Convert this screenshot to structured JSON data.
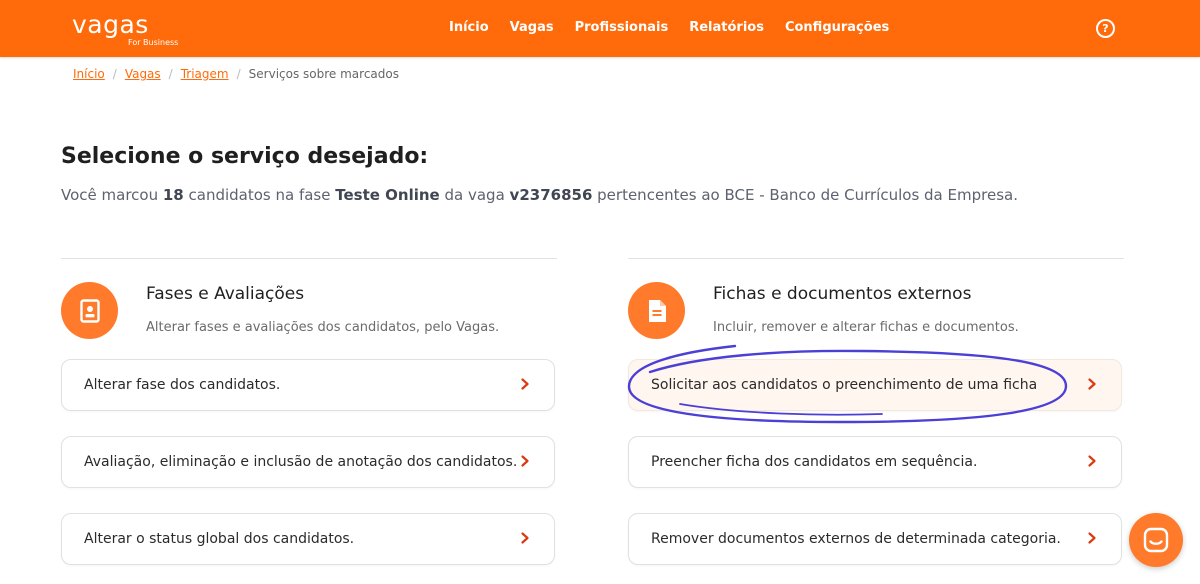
{
  "header": {
    "logo": "vagas",
    "logo_sub": "For Business",
    "nav": [
      "Início",
      "Vagas",
      "Profissionais",
      "Relatórios",
      "Configurações"
    ],
    "help_label": "?"
  },
  "breadcrumb": {
    "items": [
      "Início",
      "Vagas",
      "Triagem"
    ],
    "current": "Serviços sobre marcados"
  },
  "page": {
    "title": "Selecione o serviço desejado:",
    "desc_1": "Você marcou ",
    "count": "18",
    "desc_2": " candidatos na fase ",
    "phase": "Teste Online",
    "desc_3": " da vaga ",
    "job": "v2376856",
    "desc_4": " pertencentes ao BCE - Banco de Currículos da Empresa."
  },
  "sections": [
    {
      "title": "Fases e Avaliações",
      "subtitle": "Alterar fases e avaliações dos candidatos, pelo Vagas.",
      "icon": "id-badge-icon",
      "items": [
        "Alterar fase dos candidatos.",
        "Avaliação, eliminação e inclusão de anotação dos candidatos.",
        "Alterar o status global dos candidatos."
      ]
    },
    {
      "title": "Fichas e documentos externos",
      "subtitle": "Incluir, remover e alterar fichas e documentos.",
      "icon": "document-icon",
      "items": [
        "Solicitar aos candidatos o preenchimento de uma ficha",
        "Preencher ficha dos candidatos em sequência.",
        "Remover documentos externos de determinada categoria."
      ]
    }
  ],
  "colors": {
    "brand": "#ff6b0a",
    "accent": "#ff7a2a",
    "chevron": "#d93a12",
    "annotation": "#4b3fd6"
  }
}
